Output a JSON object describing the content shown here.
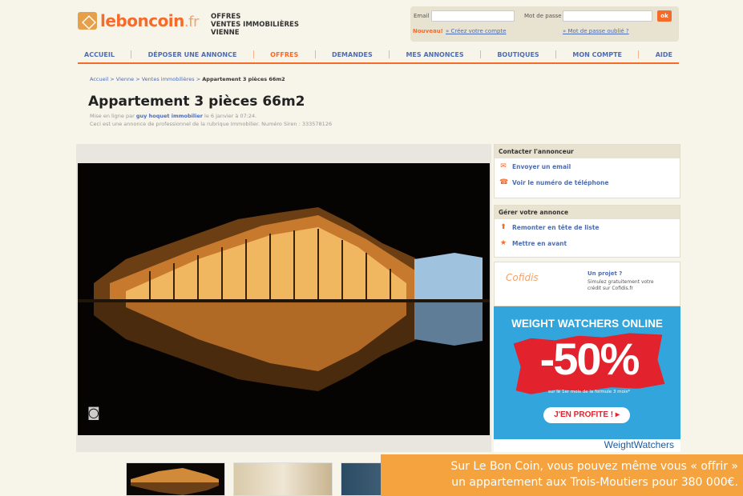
{
  "logo": {
    "name": "leboncoin",
    "tld": ".fr"
  },
  "section": {
    "line1": "OFFRES",
    "line2": "VENTES IMMOBILIÈRES",
    "line3": "VIENNE"
  },
  "login": {
    "email_label": "Email",
    "password_label": "Mot de passe",
    "ok": "ok",
    "new_label": "Nouveau!",
    "create_account": "» Créez votre compte",
    "forgot": "» Mot de passe oublié ?"
  },
  "nav": [
    "ACCUEIL",
    "DÉPOSER UNE ANNONCE",
    "OFFRES",
    "DEMANDES",
    "MES ANNONCES",
    "BOUTIQUES",
    "MON COMPTE",
    "AIDE"
  ],
  "nav_active": "OFFRES",
  "breadcrumb": {
    "path": "Accueil > Vienne > Ventes immobilières > ",
    "current": "Appartement 3 pièces 66m2"
  },
  "listing": {
    "title": "Appartement 3 pièces 66m2",
    "posted_prefix": "Mise en ligne par ",
    "posted_by": "guy hoquet immobilier",
    "posted_suffix": " le 6 janvier à 07:24.",
    "pro_note": "Ceci est une annonce de professionnel de la rubrique Immobilier. Numéro Siren : 333578126"
  },
  "contact": {
    "header": "Contacter l'annonceur",
    "email": "Envoyer un email",
    "phone": "Voir le numéro de téléphone"
  },
  "manage": {
    "header": "Gérer votre annonce",
    "bump": "Remonter en tête de liste",
    "feature": "Mettre en avant"
  },
  "cofidis": {
    "logo": "Cofidis",
    "title": "Un projet ?",
    "text": "Simulez gratuitement votre crédit sur Cofidis.fr"
  },
  "ad": {
    "headline": "WEIGHT WATCHERS ONLINE",
    "discount": "-50%",
    "small": "sur le 1er mois de la formule 3 mois*",
    "cta": "J'EN PROFITE ! ▸",
    "brand": "WeightWatchers"
  },
  "caption": {
    "line1": "Sur Le Bon Coin, vous pouvez même vous « offrir »",
    "line2": "un appartement aux Trois-Moutiers pour 380 000€."
  },
  "colors": {
    "brand_orange": "#f56b2a",
    "link_blue": "#4e6db3",
    "caption_bg": "#f5a33e",
    "ad_blue": "#32a6dc"
  }
}
